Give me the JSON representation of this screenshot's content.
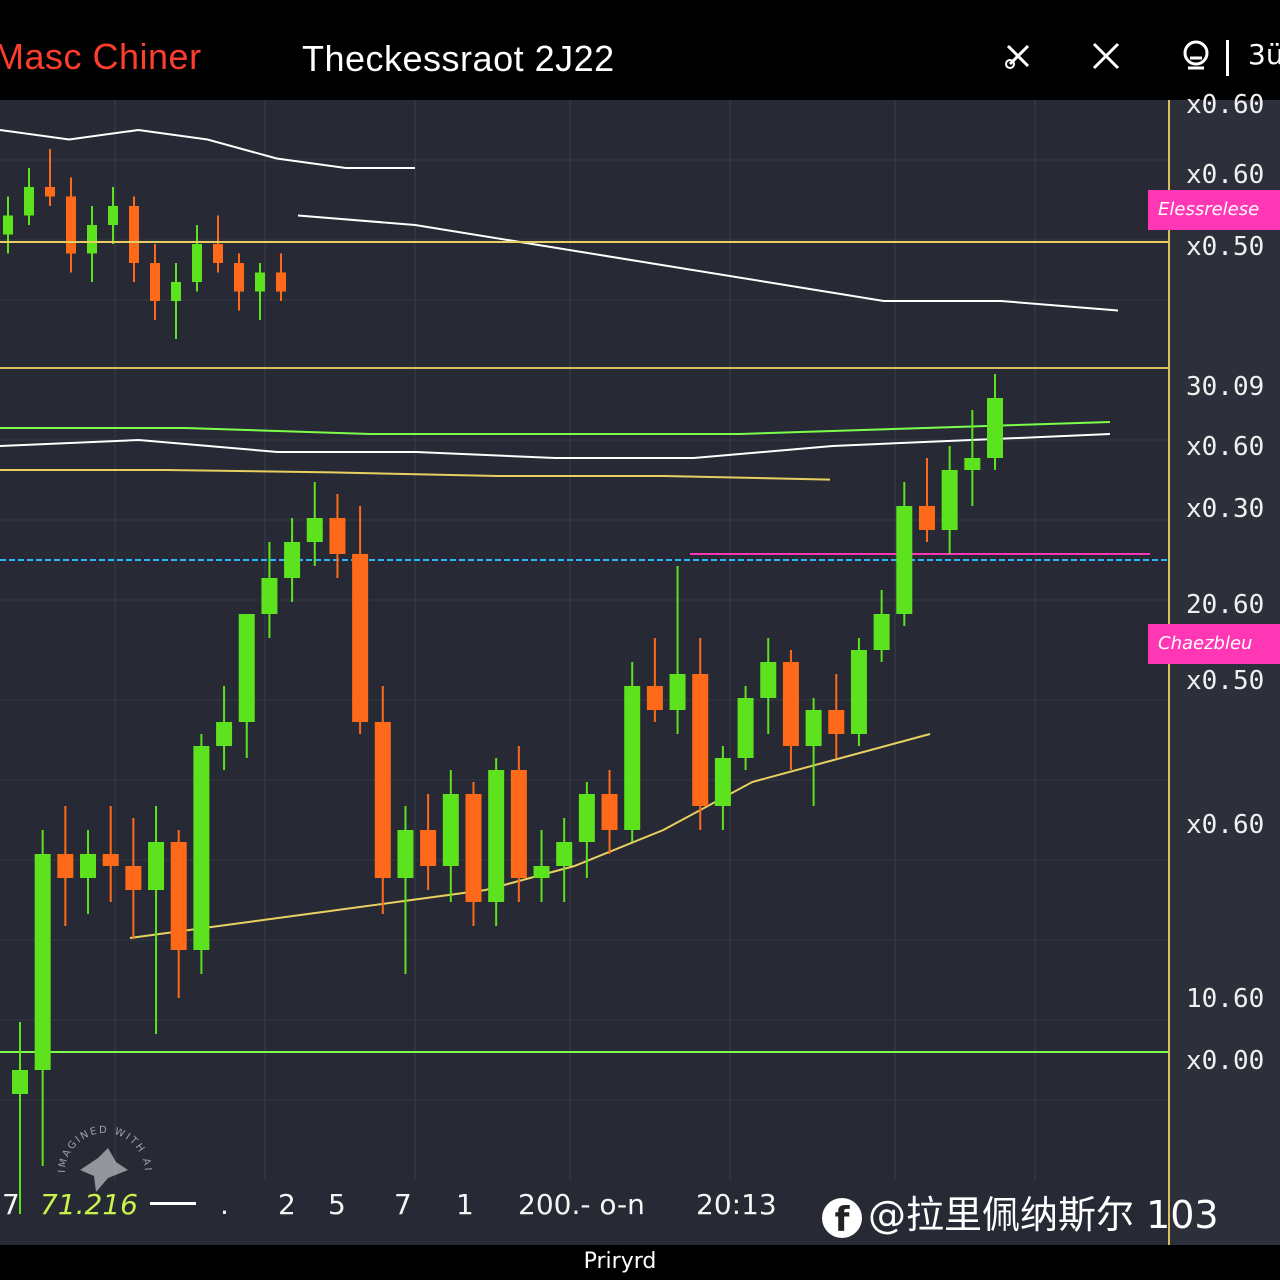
{
  "header": {
    "app_title": "Masc Chiner",
    "chart_title": "Theckessraot 2J22",
    "right_text": "3ü"
  },
  "price_axis": {
    "labels": [
      "x0.60",
      "x0.60",
      "x0.50",
      "30.09",
      "x0.60",
      "x0.30",
      "20.60",
      "x0.50",
      "x0.60",
      "10.60",
      "x0.00"
    ],
    "markers": [
      "Elessrelese",
      "Chaezbleu"
    ]
  },
  "time_axis": {
    "labels": [
      "7",
      "71.216",
      ".",
      "2",
      "5",
      "7",
      "1",
      "200.- o-n",
      "20:13"
    ]
  },
  "watermark": "@拉里佩纳斯尔 103",
  "footer": {
    "period": "Priryrd"
  },
  "badge": {
    "text": "IMAGINED WITH AI"
  },
  "colors": {
    "background": "#272a34",
    "bull": "#5ce31e",
    "bear": "#ff6a1a",
    "marker": "#ff37b4",
    "title_accent": "#ff3d2e",
    "axis_line": "#d8c060"
  },
  "chart_data": {
    "type": "line",
    "title": "Theckessraot 2J22",
    "upper_panel": {
      "ohlc": [
        [
          24.5,
          24.9,
          24.3,
          24.7
        ],
        [
          24.7,
          25.2,
          24.6,
          25.0
        ],
        [
          25.0,
          25.4,
          24.8,
          24.9
        ],
        [
          24.9,
          25.1,
          24.1,
          24.3
        ],
        [
          24.3,
          24.8,
          24.0,
          24.6
        ],
        [
          24.6,
          25.0,
          24.4,
          24.8
        ],
        [
          24.8,
          24.9,
          24.0,
          24.2
        ],
        [
          24.2,
          24.4,
          23.6,
          23.8
        ],
        [
          23.8,
          24.2,
          23.4,
          24.0
        ],
        [
          24.0,
          24.6,
          23.9,
          24.4
        ],
        [
          24.4,
          24.7,
          24.1,
          24.2
        ],
        [
          24.2,
          24.3,
          23.7,
          23.9
        ],
        [
          23.9,
          24.2,
          23.6,
          24.1
        ],
        [
          24.1,
          24.3,
          23.8,
          23.9
        ]
      ],
      "lines": [
        {
          "values": [
            25.6,
            25.5,
            25.6,
            25.5,
            25.3,
            25.2,
            25.2
          ]
        },
        {
          "values": [
            24.7,
            24.6,
            24.4,
            24.2,
            24.0,
            23.8,
            23.8,
            23.7
          ]
        }
      ]
    },
    "lower_panel": {
      "ohlc": [
        [
          16.0,
          16.6,
          15.0,
          16.2
        ],
        [
          16.2,
          18.2,
          15.4,
          18.0
        ],
        [
          18.0,
          18.4,
          17.4,
          17.8
        ],
        [
          17.8,
          18.2,
          17.5,
          18.0
        ],
        [
          18.0,
          18.4,
          17.6,
          17.9
        ],
        [
          17.9,
          18.3,
          17.3,
          17.7
        ],
        [
          17.7,
          18.4,
          16.5,
          18.1
        ],
        [
          18.1,
          18.2,
          16.8,
          17.2
        ],
        [
          17.2,
          19.0,
          17.0,
          18.9
        ],
        [
          18.9,
          19.4,
          18.7,
          19.1
        ],
        [
          19.1,
          19.5,
          18.8,
          20.0
        ],
        [
          20.0,
          20.6,
          19.8,
          20.3
        ],
        [
          20.3,
          20.8,
          20.1,
          20.6
        ],
        [
          20.6,
          21.1,
          20.4,
          20.8
        ],
        [
          20.8,
          21.0,
          20.3,
          20.5
        ],
        [
          20.5,
          20.9,
          19.0,
          19.1
        ],
        [
          19.1,
          19.4,
          17.5,
          17.8
        ],
        [
          17.8,
          18.4,
          17.0,
          18.2
        ],
        [
          18.2,
          18.5,
          17.7,
          17.9
        ],
        [
          17.9,
          18.7,
          17.6,
          18.5
        ],
        [
          18.5,
          18.6,
          17.4,
          17.6
        ],
        [
          17.6,
          18.8,
          17.4,
          18.7
        ],
        [
          18.7,
          18.9,
          17.6,
          17.8
        ],
        [
          17.8,
          18.2,
          17.6,
          17.9
        ],
        [
          17.9,
          18.3,
          17.6,
          18.1
        ],
        [
          18.1,
          18.6,
          17.8,
          18.5
        ],
        [
          18.5,
          18.7,
          18.0,
          18.2
        ],
        [
          18.2,
          19.6,
          18.1,
          19.4
        ],
        [
          19.4,
          19.8,
          19.1,
          19.2
        ],
        [
          19.2,
          20.4,
          19.0,
          19.5
        ],
        [
          19.5,
          19.8,
          18.2,
          18.4
        ],
        [
          18.4,
          18.9,
          18.2,
          18.8
        ],
        [
          18.8,
          19.4,
          18.7,
          19.3
        ],
        [
          19.3,
          19.8,
          19.0,
          19.6
        ],
        [
          19.6,
          19.7,
          18.7,
          18.9
        ],
        [
          18.9,
          19.3,
          18.4,
          19.2
        ],
        [
          19.2,
          19.5,
          18.8,
          19.0
        ],
        [
          19.0,
          19.8,
          18.9,
          19.7
        ],
        [
          19.7,
          20.2,
          19.6,
          20.0
        ],
        [
          20.0,
          21.1,
          19.9,
          20.9
        ],
        [
          20.9,
          21.3,
          20.6,
          20.7
        ],
        [
          20.7,
          21.4,
          20.5,
          21.2
        ],
        [
          21.2,
          21.7,
          20.9,
          21.3
        ],
        [
          21.3,
          22.0,
          21.2,
          21.8
        ]
      ],
      "lines": [
        {
          "values": [
            21.55,
            21.55,
            21.5,
            21.5,
            21.5,
            21.55,
            21.6
          ]
        },
        {
          "values": [
            21.4,
            21.45,
            21.35,
            21.35,
            21.3,
            21.3,
            21.4,
            21.45,
            21.5
          ]
        },
        {
          "values": [
            21.2,
            21.2,
            21.18,
            21.15,
            21.15,
            21.12
          ]
        },
        {
          "values": [
            20.5,
            20.5,
            20.5,
            20.5,
            20.5,
            20.5,
            20.5,
            20.5
          ]
        },
        {
          "values": [
            17.3,
            17.4,
            17.5,
            17.6,
            17.7,
            17.9,
            18.2,
            18.6,
            18.8,
            19.0
          ]
        }
      ],
      "horizontal_levels": [
        {
          "value": 23.1,
          "color": "#e8d060"
        },
        {
          "value": 20.45,
          "color": "#2bb7ff"
        },
        {
          "value": 16.35,
          "color": "#7cff4a"
        }
      ]
    },
    "grid": true
  }
}
